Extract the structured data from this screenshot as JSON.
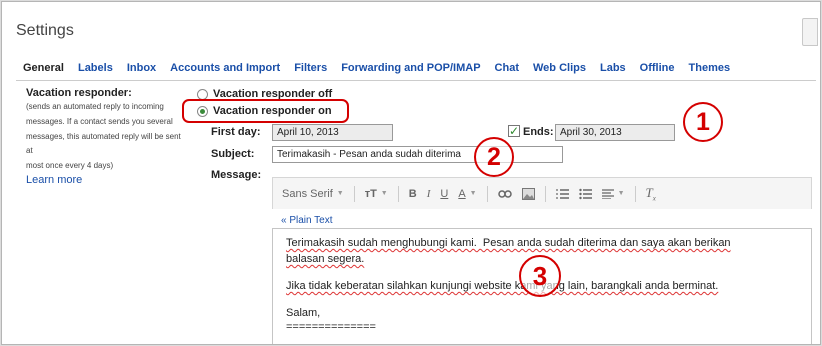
{
  "window": {
    "title": "Settings"
  },
  "tabs": [
    "General",
    "Labels",
    "Inbox",
    "Accounts and Import",
    "Filters",
    "Forwarding and POP/IMAP",
    "Chat",
    "Web Clips",
    "Labs",
    "Offline",
    "Themes"
  ],
  "vacation": {
    "label": "Vacation responder:",
    "desc_lines": [
      "(sends an automated reply to incoming",
      "messages. If a contact sends you several",
      "messages, this automated reply will be sent at",
      "most once every 4 days)"
    ],
    "learn_more": "Learn more",
    "off_label": "Vacation responder off",
    "on_label": "Vacation responder on",
    "first_day_label": "First day:",
    "first_day_value": "April 10, 2013",
    "ends_label": "Ends:",
    "ends_value": "April 30, 2013",
    "subject_label": "Subject:",
    "subject_value": "Terimakasih - Pesan anda sudah diterima",
    "message_label": "Message:"
  },
  "editor": {
    "font_name": "Sans Serif",
    "plain_text_link": "« Plain Text",
    "body_lines": [
      "Terimakasih sudah menghubungi kami.  Pesan anda sudah diterima dan saya akan berikan",
      "balasan segera.",
      "",
      "Jika tidak keberatan silahkan kunjungi website kami yang lain, barangkali anda berminat.",
      "",
      "Salam,",
      "=============="
    ]
  },
  "annotations": {
    "one": "1",
    "two": "2",
    "three": "3"
  },
  "colors": {
    "link": "#1a4fa8",
    "annotation": "#d40000",
    "check": "#2f8a2f"
  }
}
